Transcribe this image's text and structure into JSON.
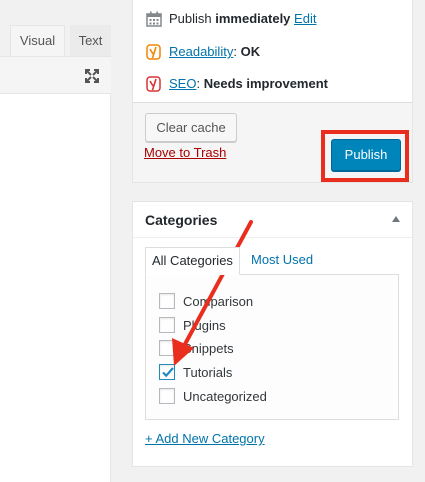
{
  "editor": {
    "tabs": {
      "visual": "Visual",
      "text": "Text"
    },
    "fullscreen_icon": "expand-icon"
  },
  "publish": {
    "schedule_label": "Publish",
    "schedule_value": "immediately",
    "schedule_edit": "Edit",
    "readability_label": "Readability",
    "readability_sep": ":",
    "readability_value": "OK",
    "seo_label": "SEO",
    "seo_sep": ":",
    "seo_value": "Needs improvement",
    "clear_cache": "Clear cache",
    "trash": "Move to Trash",
    "publish_button": "Publish",
    "colors": {
      "readability": "#f18500",
      "seo": "#dc3232",
      "highlight": "#ea2e1e",
      "button": "#0085ba"
    }
  },
  "categories": {
    "title": "Categories",
    "tabs": {
      "all": "All Categories",
      "most_used": "Most Used"
    },
    "items": [
      {
        "label": "Comparison",
        "checked": false
      },
      {
        "label": "Plugins",
        "checked": false
      },
      {
        "label": "Snippets",
        "checked": false
      },
      {
        "label": "Tutorials",
        "checked": true
      },
      {
        "label": "Uncategorized",
        "checked": false
      }
    ],
    "add_new": "+ Add New Category"
  },
  "annotation": {
    "arrow_color": "#ea2e1e"
  }
}
